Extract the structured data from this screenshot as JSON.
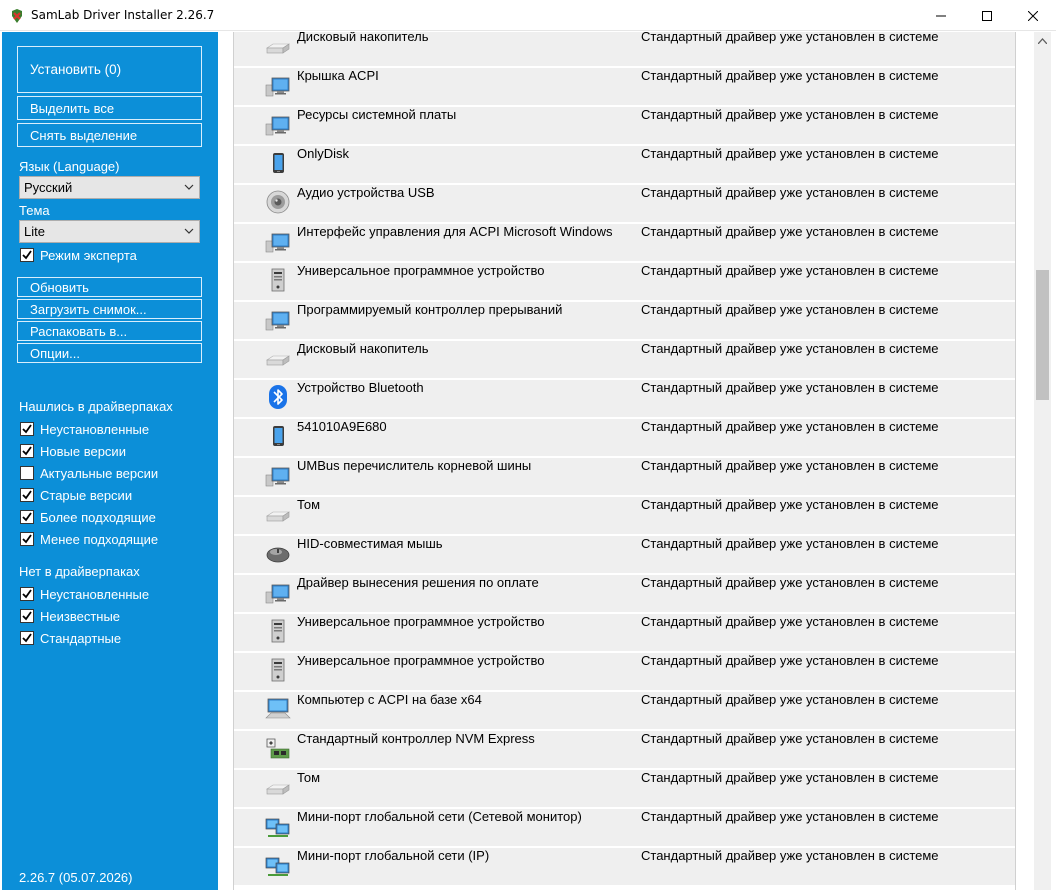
{
  "window": {
    "title": "SamLab Driver Installer 2.26.7"
  },
  "sidebar": {
    "install_label": "Установить (0)",
    "select_all_label": "Выделить все",
    "deselect_label": "Снять выделение",
    "language_label": "Язык (Language)",
    "language_value": "Русский",
    "theme_label": "Тема",
    "theme_value": "Lite",
    "expert_mode_label": "Режим эксперта",
    "expert_mode_checked": true,
    "refresh_label": "Обновить",
    "load_snapshot_label": "Загрузить снимок...",
    "unpack_label": "Распаковать в...",
    "options_label": "Опции...",
    "found_header": "Нашлись в драйверпаках",
    "found_filters": [
      {
        "label": "Неустановленные",
        "checked": true
      },
      {
        "label": "Новые версии",
        "checked": true
      },
      {
        "label": "Актуальные версии",
        "checked": false
      },
      {
        "label": "Старые версии",
        "checked": true
      },
      {
        "label": "Более подходящие",
        "checked": true
      },
      {
        "label": "Менее подходящие",
        "checked": true
      }
    ],
    "notfound_header": "Нет в драйверпаках",
    "notfound_filters": [
      {
        "label": "Неустановленные",
        "checked": true
      },
      {
        "label": "Неизвестные",
        "checked": true
      },
      {
        "label": "Стандартные",
        "checked": true
      }
    ],
    "version": "2.26.7 (05.07.2026)"
  },
  "devices": [
    {
      "name": "Дисковый накопитель",
      "status": "Стандартный драйвер уже установлен в системе",
      "icon": "disk-drive-icon"
    },
    {
      "name": "Крышка ACPI",
      "status": "Стандартный драйвер уже установлен в системе",
      "icon": "system-device-icon"
    },
    {
      "name": "Ресурсы системной платы",
      "status": "Стандартный драйвер уже установлен в системе",
      "icon": "system-device-icon"
    },
    {
      "name": "OnlyDisk",
      "status": "Стандартный драйвер уже установлен в системе",
      "icon": "portable-device-icon"
    },
    {
      "name": "Аудио устройства USB",
      "status": "Стандартный драйвер уже установлен в системе",
      "icon": "speaker-icon"
    },
    {
      "name": "Интерфейс управления для ACPI Microsoft Windows",
      "status": "Стандартный драйвер уже установлен в системе",
      "icon": "system-device-icon"
    },
    {
      "name": "Универсальное программное устройство",
      "status": "Стандартный драйвер уже установлен в системе",
      "icon": "software-device-icon"
    },
    {
      "name": "Программируемый контроллер прерываний",
      "status": "Стандартный драйвер уже установлен в системе",
      "icon": "system-device-icon"
    },
    {
      "name": "Дисковый накопитель",
      "status": "Стандартный драйвер уже установлен в системе",
      "icon": "disk-drive-icon"
    },
    {
      "name": "Устройство Bluetooth",
      "status": "Стандартный драйвер уже установлен в системе",
      "icon": "bluetooth-icon"
    },
    {
      "name": "541010A9E680",
      "status": "Стандартный драйвер уже установлен в системе",
      "icon": "portable-device-icon"
    },
    {
      "name": "UMBus перечислитель корневой шины",
      "status": "Стандартный драйвер уже установлен в системе",
      "icon": "system-device-icon"
    },
    {
      "name": "Том",
      "status": "Стандартный драйвер уже установлен в системе",
      "icon": "disk-drive-icon"
    },
    {
      "name": "HID-совместимая мышь",
      "status": "Стандартный драйвер уже установлен в системе",
      "icon": "mouse-icon"
    },
    {
      "name": "Драйвер вынесения решения по оплате",
      "status": "Стандартный драйвер уже установлен в системе",
      "icon": "system-device-icon"
    },
    {
      "name": "Универсальное программное устройство",
      "status": "Стандартный драйвер уже установлен в системе",
      "icon": "software-device-icon"
    },
    {
      "name": "Универсальное программное устройство",
      "status": "Стандартный драйвер уже установлен в системе",
      "icon": "software-device-icon"
    },
    {
      "name": "Компьютер с ACPI на базе x64",
      "status": "Стандартный драйвер уже установлен в системе",
      "icon": "computer-icon"
    },
    {
      "name": "Стандартный контроллер NVM Express",
      "status": "Стандартный драйвер уже установлен в системе",
      "icon": "storage-controller-icon"
    },
    {
      "name": "Том",
      "status": "Стандартный драйвер уже установлен в системе",
      "icon": "disk-drive-icon"
    },
    {
      "name": "Мини-порт глобальной сети (Сетевой монитор)",
      "status": "Стандартный драйвер уже установлен в системе",
      "icon": "network-adapter-icon"
    },
    {
      "name": "Мини-порт глобальной сети (IP)",
      "status": "Стандартный драйвер уже установлен в системе",
      "icon": "network-adapter-icon"
    }
  ],
  "colors": {
    "sidebar_bg": "#0c8fd8",
    "row_bg": "#efefef",
    "bluetooth": "#1a73e8"
  }
}
